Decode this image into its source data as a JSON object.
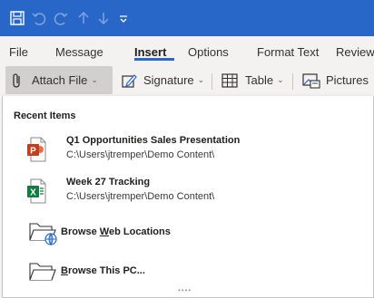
{
  "quick_access": {
    "icons": [
      "save-icon",
      "undo-icon",
      "redo-icon",
      "up-arrow-icon",
      "down-arrow-icon",
      "customize-qat-icon"
    ]
  },
  "menu": {
    "items": [
      {
        "label": "File"
      },
      {
        "label": "Message"
      },
      {
        "label": "Insert"
      },
      {
        "label": "Options"
      },
      {
        "label": "Format Text"
      },
      {
        "label": "Review"
      }
    ],
    "active": "Insert"
  },
  "toolbar": {
    "attach_file": "Attach File",
    "signature": "Signature",
    "table": "Table",
    "pictures": "Pictures"
  },
  "dropdown": {
    "heading": "Recent Items",
    "recent": [
      {
        "title": "Q1 Opportunities Sales Presentation",
        "path": "C:\\Users\\jtremper\\Demo Content\\",
        "icon": "powerpoint-file-icon"
      },
      {
        "title": "Week 27 Tracking",
        "path": "C:\\Users\\jtremper\\Demo Content\\",
        "icon": "excel-file-icon"
      }
    ],
    "browse_web": {
      "pre": "Browse ",
      "accel": "W",
      "post": "eb Locations"
    },
    "browse_pc": {
      "pre": "",
      "accel": "B",
      "post": "rowse This PC..."
    }
  },
  "colors": {
    "title_bar": "#2867c8",
    "ribbon": "#f3f2f1",
    "powerpoint": "#c43e1c",
    "excel": "#107c41"
  }
}
